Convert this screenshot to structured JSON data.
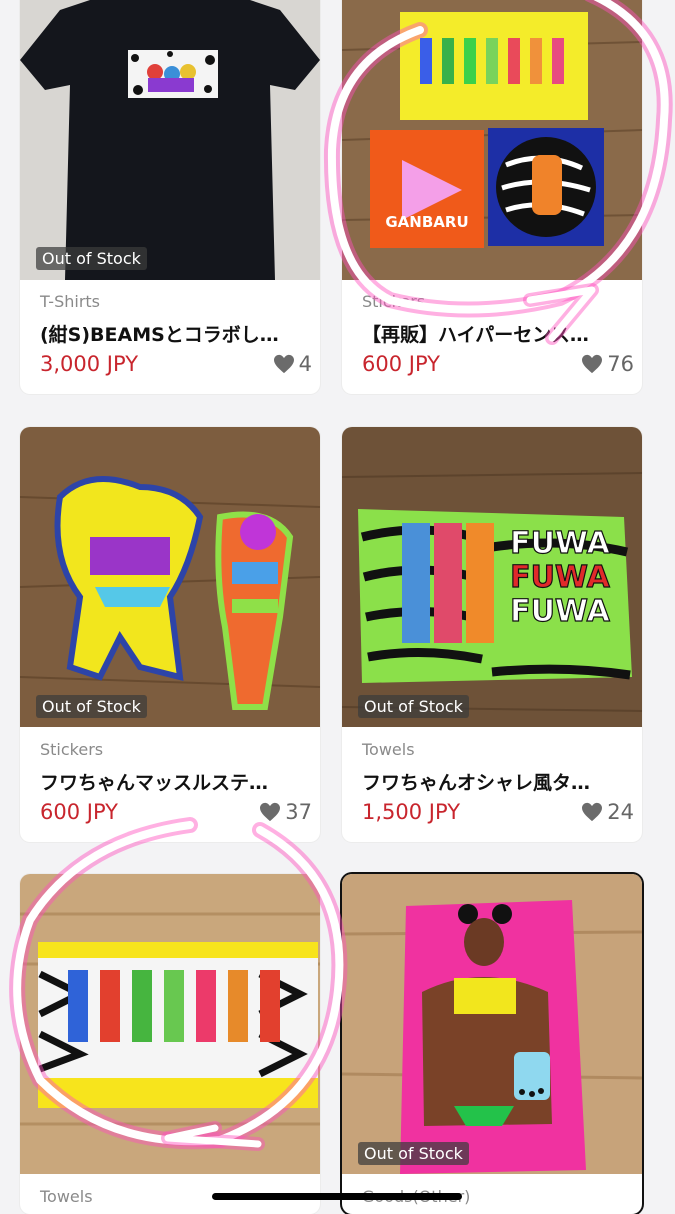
{
  "products": [
    {
      "category": "T-Shirts",
      "title": "(紺S)BEAMSとコラボし…",
      "price": "3,000 JPY",
      "likes": "4",
      "badge": "Out of Stock"
    },
    {
      "category": "Stickers",
      "title": "【再販】ハイパーセンス…",
      "price": "600 JPY",
      "likes": "76",
      "badge": ""
    },
    {
      "category": "Stickers",
      "title": "フワちゃんマッスルステ…",
      "price": "600 JPY",
      "likes": "37",
      "badge": "Out of Stock"
    },
    {
      "category": "Towels",
      "title": "フワちゃんオシャレ風タ…",
      "price": "1,500 JPY",
      "likes": "24",
      "badge": "Out of Stock"
    },
    {
      "category": "Towels",
      "title": "",
      "price": "",
      "likes": "",
      "badge": ""
    },
    {
      "category": "Goods(Other)",
      "title": "",
      "price": "",
      "likes": "",
      "badge": "Out of Stock"
    }
  ],
  "artwork": {
    "ganbaru": "GANBARU",
    "fuwa1": "FUWA",
    "fuwa2": "FUWA",
    "fuwa3": "FUWA"
  },
  "colors": {
    "price_red": "#c8252d",
    "annotation_pink": "#ff3fb4",
    "background": "#f3f3f5"
  }
}
